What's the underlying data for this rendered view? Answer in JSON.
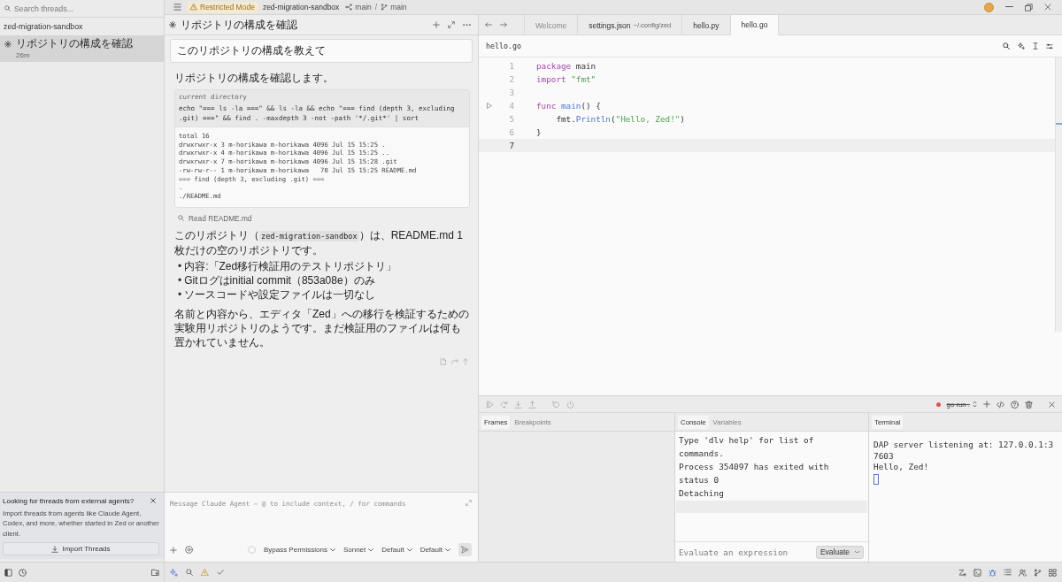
{
  "sidebar": {
    "search": {
      "placeholder": "Search threads..."
    },
    "project": "zed-migration-sandbox",
    "threads": [
      {
        "title": "リポジトリの構成を確認",
        "time": "26m",
        "selected": true
      }
    ],
    "notice": {
      "title": "Looking for threads from external agents?",
      "body": "Import threads from agents like Claude Agent, Codex, and more, whether started in Zed or another client.",
      "button": "Import Threads"
    }
  },
  "title_bar": {
    "restricted_mode": "Restricted Mode",
    "project": "zed-migration-sandbox",
    "worktree": "main",
    "separator": "/",
    "branch": "main"
  },
  "agent_panel": {
    "title": "リポジトリの構成を確認",
    "user_message": "このリポジトリの構成を教えて",
    "response": [
      {
        "kind": "text",
        "text": "リポジトリの構成を確認します。"
      },
      {
        "kind": "terminal",
        "label": "current directory",
        "command": "echo \"=== ls -la ===\" && ls -la && echo \"=== find (depth 3, excluding .git) ===\" && find . -maxdepth 3 -not -path '*/.git*' | sort",
        "output": [
          "total 16",
          "drwxrwxr-x 3 m-horikawa m-horikawa 4096 Jul 15 15:25 .",
          "drwxrwxr-x 4 m-horikawa m-horikawa 4096 Jul 15 15:25 ..",
          "drwxrwxr-x 7 m-horikawa m-horikawa 4096 Jul 15 15:28 .git",
          "-rw-rw-r-- 1 m-horikawa m-horikawa   70 Jul 15 15:25 README.md",
          "=== find (depth 3, excluding .git) ===",
          ".",
          "./README.md"
        ]
      },
      {
        "kind": "tool",
        "text": "Read README.md"
      },
      {
        "kind": "paragraph",
        "parts": [
          {
            "kind": "text",
            "text": "このリポジトリ（"
          },
          {
            "kind": "code",
            "text": "zed-migration-sandbox"
          },
          {
            "kind": "text",
            "text": "）は、README.md 1枚だけの空のリポジトリです。"
          }
        ]
      },
      {
        "kind": "list",
        "marker": "•",
        "items": [
          "内容:「Zed移行検証用のテストリポジトリ」",
          "Gitログはinitial commit（853a08e）のみ",
          "ソースコードや設定ファイルは一切なし"
        ]
      },
      {
        "kind": "text",
        "text": "名前と内容から、エディタ「Zed」への移行を検証するための実験用リポジトリのようです。まだ検証用のファイルは何も置かれていません。"
      }
    ],
    "composer": {
      "placeholder": "Message Claude Agent — @ to include context, / for commands",
      "mode": "Bypass Permissions",
      "model": "Sonnet",
      "options": [
        "Default",
        "Default"
      ]
    }
  },
  "editor": {
    "tabs": [
      {
        "label": "Welcome",
        "selected": false,
        "preview": true
      },
      {
        "label": "settings.json",
        "detail": "~/.config/zed",
        "selected": false,
        "preview": false
      },
      {
        "label": "hello.py",
        "selected": false,
        "preview": false
      },
      {
        "label": "hello.go",
        "selected": true,
        "preview": false
      }
    ],
    "breadcrumb": "hello.go",
    "lines": [
      {
        "number": "1",
        "current": false,
        "runnable": false,
        "tokens": [
          {
            "kind": "keyword",
            "text": "package"
          },
          {
            "kind": "plain",
            "text": " main"
          }
        ]
      },
      {
        "number": "2",
        "current": false,
        "runnable": false,
        "tokens": [
          {
            "kind": "keyword",
            "text": "import "
          },
          {
            "kind": "string",
            "text": "\"fmt\""
          }
        ]
      },
      {
        "number": "3",
        "current": false,
        "runnable": false
      },
      {
        "number": "4",
        "current": false,
        "runnable": true,
        "tokens": [
          {
            "kind": "keyword",
            "text": "func "
          },
          {
            "kind": "function",
            "text": "main"
          },
          {
            "kind": "plain",
            "text": "() {"
          }
        ]
      },
      {
        "number": "5",
        "current": false,
        "runnable": false,
        "tokens": [
          {
            "kind": "plain",
            "text": "    fmt."
          },
          {
            "kind": "function",
            "text": "Println"
          },
          {
            "kind": "plain",
            "text": "("
          },
          {
            "kind": "string",
            "text": "\"Hello, Zed!\""
          },
          {
            "kind": "plain",
            "text": ")"
          }
        ]
      },
      {
        "number": "6",
        "current": false,
        "runnable": false,
        "tokens": [
          {
            "kind": "plain",
            "text": "}"
          }
        ]
      },
      {
        "number": "7",
        "current": true,
        "runnable": false
      }
    ]
  },
  "debug_panel": {
    "session": {
      "label": "go run .",
      "terminated": true
    },
    "frames_tabs": [
      {
        "label": "Frames",
        "selected": true
      },
      {
        "label": "Breakpoints",
        "selected": false
      }
    ],
    "console_tabs": [
      {
        "label": "Console",
        "selected": true
      },
      {
        "label": "Variables",
        "selected": false
      }
    ],
    "console_lines": [
      "Type 'dlv help' for list of commands.",
      "Process 354097 has exited with status 0",
      "Detaching"
    ],
    "console_input": {
      "placeholder": "Evaluate an expression",
      "button": "Evaluate"
    },
    "terminal_tabs": [
      {
        "label": "Terminal",
        "selected": true
      }
    ],
    "terminal_lines": [
      "DAP server listening at: 127.0.0.1:37603",
      "Hello, Zed!"
    ]
  },
  "status_bar": {
    "sidebar_tools": [
      {
        "active": false
      },
      {
        "active": false
      },
      {
        "active": false
      }
    ],
    "left_tools": [
      {
        "active": true
      },
      {
        "active": false
      },
      {
        "active": false
      },
      {
        "active": false
      }
    ],
    "right_tools": [
      {
        "active": false
      },
      {
        "active": false
      },
      {
        "active": true
      },
      {
        "active": false
      },
      {
        "active": false
      },
      {
        "active": false
      },
      {
        "active": false
      }
    ]
  }
}
